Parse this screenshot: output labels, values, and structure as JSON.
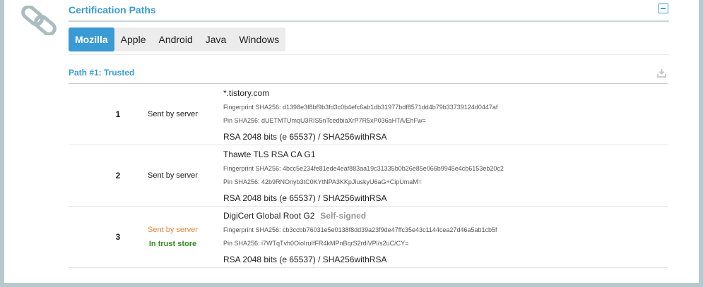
{
  "section": {
    "title": "Certification Paths"
  },
  "tabs": [
    {
      "label": "Mozilla"
    },
    {
      "label": "Apple"
    },
    {
      "label": "Android"
    },
    {
      "label": "Java"
    },
    {
      "label": "Windows"
    }
  ],
  "path": {
    "title": "Path #1: Trusted"
  },
  "certs": [
    {
      "num": "1",
      "status": "Sent by server",
      "cn": "*.tistory.com",
      "fingerprint": "Fingerprint SHA256: d1398e3f8bf9b3fd3c0b4efc6ab1db31977bdf8571dd4b79b33739124d0447af",
      "pin": "Pin SHA256: dUETMTUmqU3RIS5nTcedbiaXrP7R5xP036aHTA/EhFw=",
      "key": "RSA 2048 bits (e 65537) / SHA256withRSA"
    },
    {
      "num": "2",
      "status": "Sent by server",
      "cn": "Thawte TLS RSA CA G1",
      "fingerprint": "Fingerprint SHA256: 4bcc5e234fe81ede4eaf883aa19c31335b0b26e85e066b9945e4cb6153eb20c2",
      "pin": "Pin SHA256: 42b9RNOnyb3tC0KYtNPA3KKpJluskyU6aG+CipUmaM=",
      "key": "RSA 2048 bits (e 65537) / SHA256withRSA"
    },
    {
      "num": "3",
      "status": "Sent by server",
      "trust": "In trust store",
      "cn": "DigiCert Global Root G2",
      "self_signed": "Self-signed",
      "fingerprint": "Fingerprint SHA256: cb3ccbb76031e5e0138f8dd39a23f9de47ffc35e43c1144cea27d46a5ab1cb5f",
      "pin": "Pin SHA256: i7WTqTvh0OioIruIfFR4kMPnBqrS2rdiVPl/s2uC/CY=",
      "key": "RSA 2048 bits (e 65537) / SHA256withRSA"
    }
  ],
  "colors": {
    "accent": "#3a9ad4",
    "frame": "#b7c9cc",
    "orange": "#e8853a",
    "green": "#2e8b1e"
  },
  "icons": {
    "section": "link-icon",
    "collapse": "minus-square-icon",
    "download": "download-icon"
  }
}
